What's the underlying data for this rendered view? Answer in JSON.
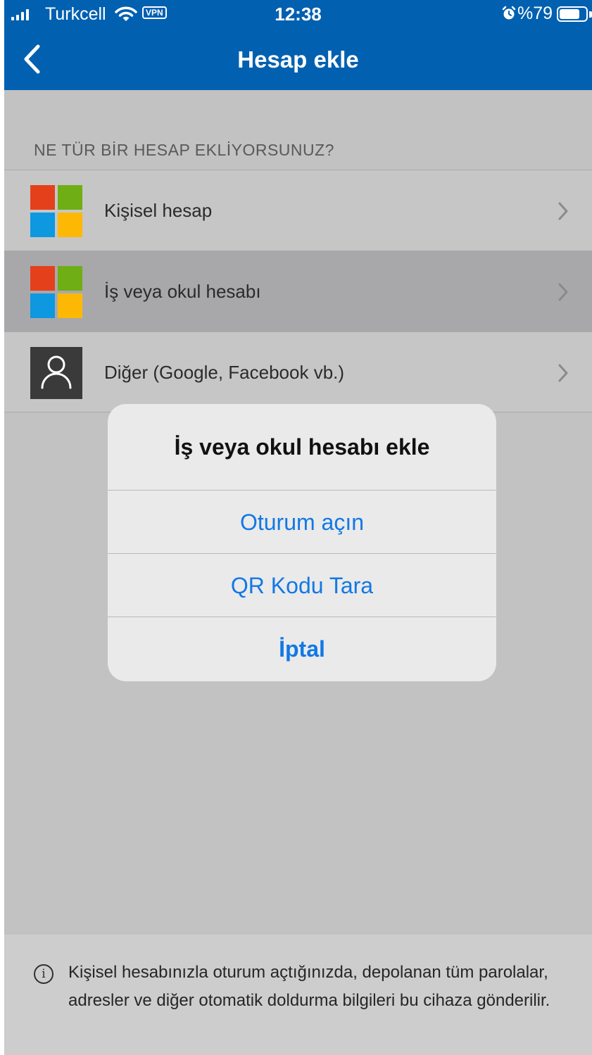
{
  "status_bar": {
    "carrier": "Turkcell",
    "vpn": "VPN",
    "time": "12:38",
    "battery": "%79",
    "battery_level": 0.79
  },
  "header": {
    "title": "Hesap ekle"
  },
  "section": {
    "title": "NE TÜR BİR HESAP EKLİYORSUNUZ?",
    "items": [
      {
        "label": "Kişisel hesap",
        "icon": "microsoft-logo-icon"
      },
      {
        "label": "İş veya okul hesabı",
        "icon": "microsoft-logo-icon",
        "highlighted": true
      },
      {
        "label": "Diğer (Google, Facebook vb.)",
        "icon": "person-icon"
      }
    ]
  },
  "info": {
    "text": "Kişisel hesabınızla oturum açtığınızda, depolanan tüm parolalar, adresler ve diğer otomatik doldurma bilgileri bu cihaza gönderilir."
  },
  "alert": {
    "title": "İş veya okul hesabı ekle",
    "buttons": [
      {
        "label": "Oturum açın"
      },
      {
        "label": "QR Kodu Tara"
      },
      {
        "label": "İptal"
      }
    ]
  },
  "colors": {
    "header": "#0160b0",
    "accent": "#1278e4",
    "ms_red": "#e5401c",
    "ms_green": "#6fae15",
    "ms_blue": "#0d98e0",
    "ms_yellow": "#fdb806"
  }
}
